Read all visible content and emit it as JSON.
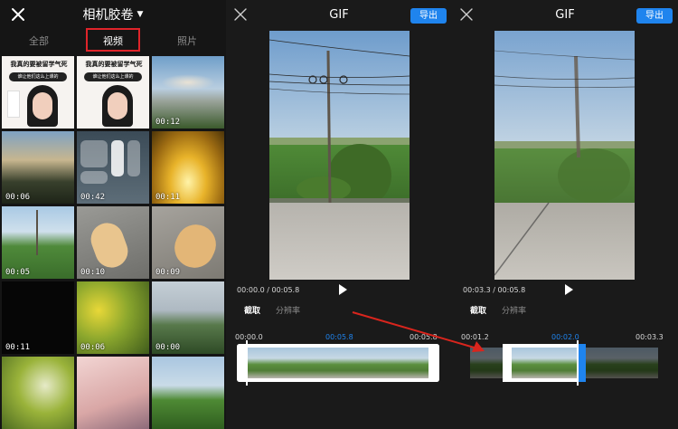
{
  "gallery": {
    "title": "相机胶卷",
    "tabs": [
      {
        "label": "全部"
      },
      {
        "label": "视频"
      },
      {
        "label": "照片"
      }
    ],
    "thumbs": [
      {
        "duration": ""
      },
      {
        "duration": ""
      },
      {
        "duration": "00:12"
      },
      {
        "duration": "00:06"
      },
      {
        "duration": "00:42"
      },
      {
        "duration": "00:11"
      },
      {
        "duration": "00:05"
      },
      {
        "duration": "00:10"
      },
      {
        "duration": "00:09"
      },
      {
        "duration": "00:11"
      },
      {
        "duration": "00:06"
      },
      {
        "duration": "00:00"
      },
      {
        "duration": ""
      },
      {
        "duration": ""
      },
      {
        "duration": ""
      }
    ],
    "poster": {
      "headline": "我真的要被留学气死",
      "subline": "谁让他们这么上课的"
    }
  },
  "editor_left": {
    "title": "GIF",
    "export_label": "导出",
    "current_time": "00:00.0",
    "separator": "/",
    "total_time": "00:05.8",
    "options": [
      {
        "label": "截取"
      },
      {
        "label": "分辨率"
      }
    ],
    "timeline": {
      "start": "00:00.0",
      "mid": "00:05.8",
      "end": "00:05.8"
    }
  },
  "editor_right": {
    "title": "GIF",
    "export_label": "导出",
    "current_time": "00:03.3",
    "separator": "/",
    "total_time": "00:05.8",
    "options": [
      {
        "label": "截取"
      },
      {
        "label": "分辨率"
      }
    ],
    "timeline": {
      "start": "00:01.2",
      "mid": "00:02.0",
      "end": "00:03.3"
    }
  },
  "colors": {
    "accent": "#1f84ee",
    "highlight": "#e0242a",
    "background": "#1a1a1a"
  }
}
